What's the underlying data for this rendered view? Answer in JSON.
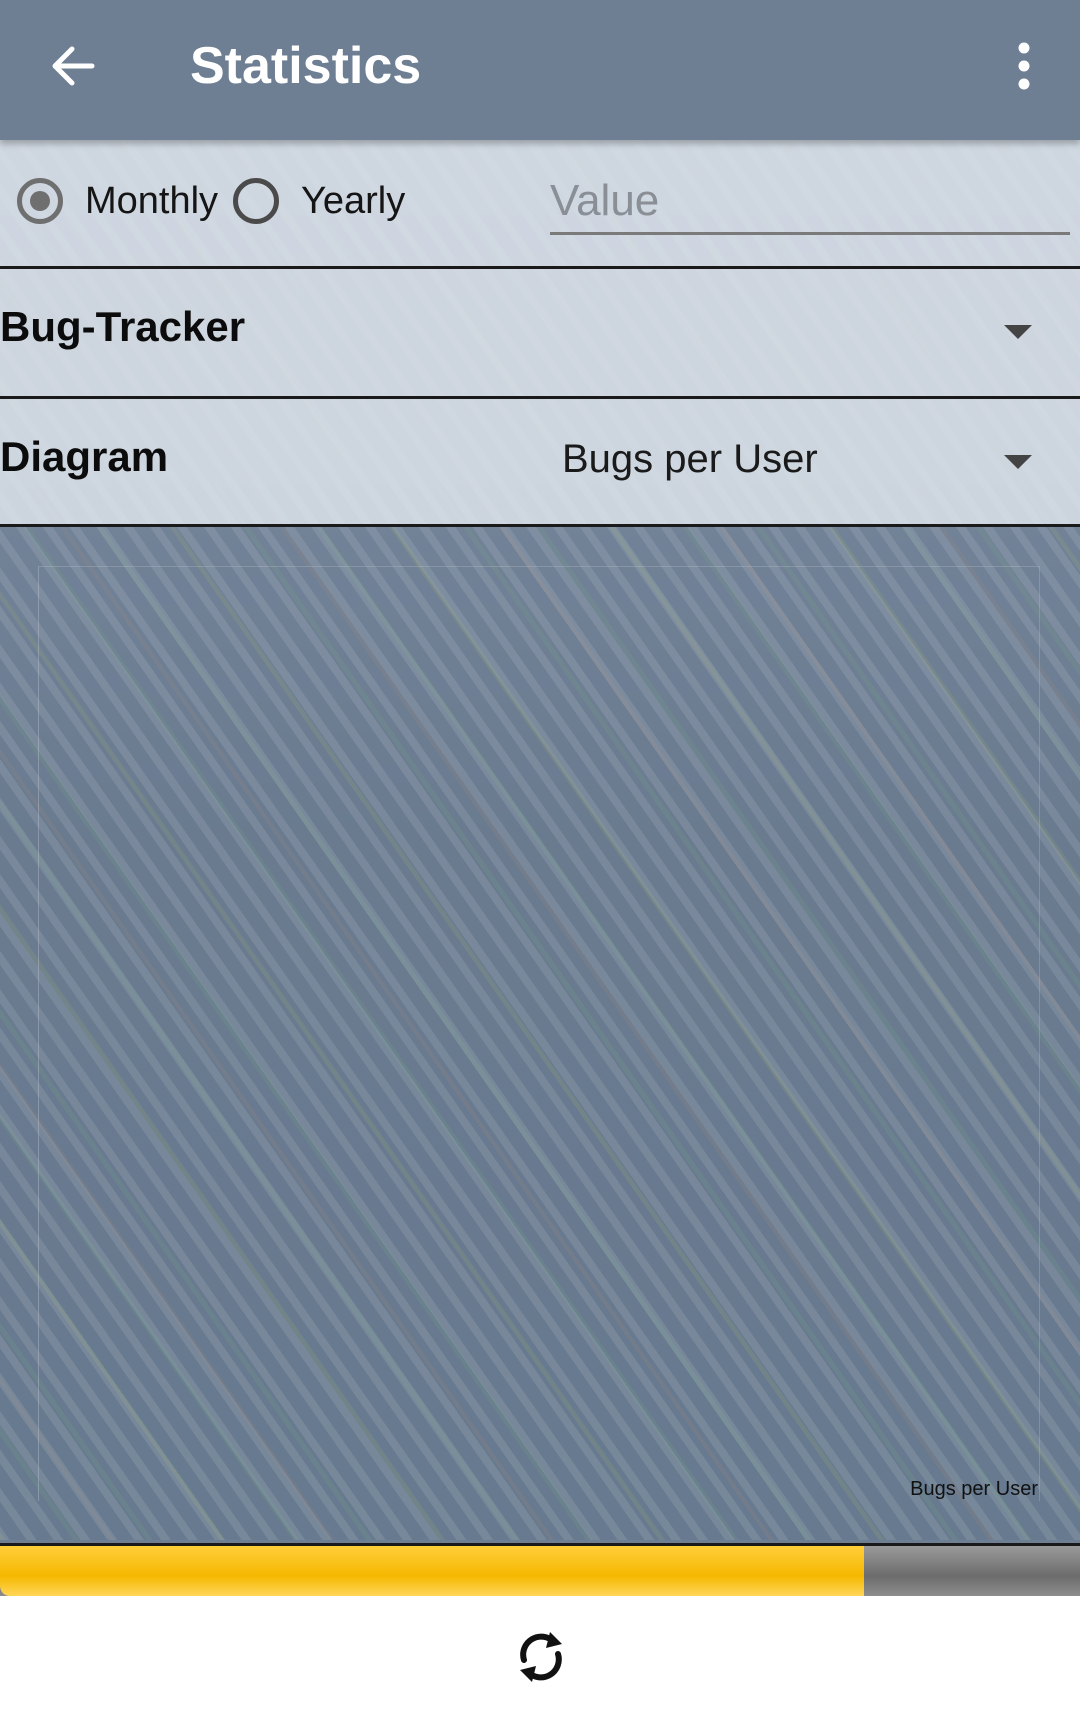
{
  "appbar": {
    "title": "Statistics"
  },
  "period": {
    "monthly_label": "Monthly",
    "yearly_label": "Yearly",
    "selected": "Monthly"
  },
  "value_input": {
    "placeholder": "Value",
    "value": ""
  },
  "tracker": {
    "label": "Bug-Tracker",
    "selected": ""
  },
  "diagram": {
    "label": "Diagram",
    "selected": "Bugs per User"
  },
  "chart": {
    "legend": "Bugs per User"
  },
  "progress": {
    "fraction": 0.8,
    "fill_color": "#f5b800"
  },
  "icons": {
    "back": "arrow-back-icon",
    "menu": "more-vert-icon",
    "refresh": "refresh-icon",
    "dropdown": "caret-down-icon"
  }
}
